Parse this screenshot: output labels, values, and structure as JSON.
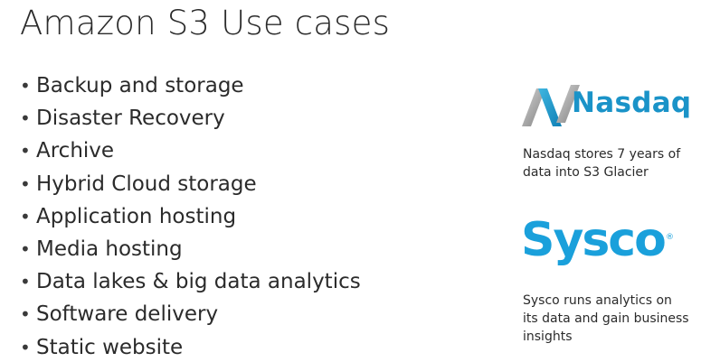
{
  "title": "Amazon S3 Use cases",
  "bullets": [
    "Backup and storage",
    "Disaster Recovery",
    "Archive",
    "Hybrid Cloud storage",
    "Application hosting",
    "Media hosting",
    "Data lakes & big data analytics",
    "Software delivery",
    "Static website"
  ],
  "nasdaq": {
    "logo_text": "Nasdaq",
    "caption_line1": "Nasdaq stores 7 years of",
    "caption_line2": "data into S3 Glacier"
  },
  "sysco": {
    "logo_text": "Sysco",
    "registered_mark": "®",
    "caption_line1": "Sysco runs analytics on",
    "caption_line2": "its data and gain business",
    "caption_line3": "insights"
  },
  "colors": {
    "text": "#2b2b2b",
    "nasdaq_blue": "#1a93c8",
    "nasdaq_gray": "#9a9a9a",
    "sysco_blue": "#1aa0db"
  },
  "icons": {
    "nasdaq_mark": "nasdaq-n-icon"
  }
}
